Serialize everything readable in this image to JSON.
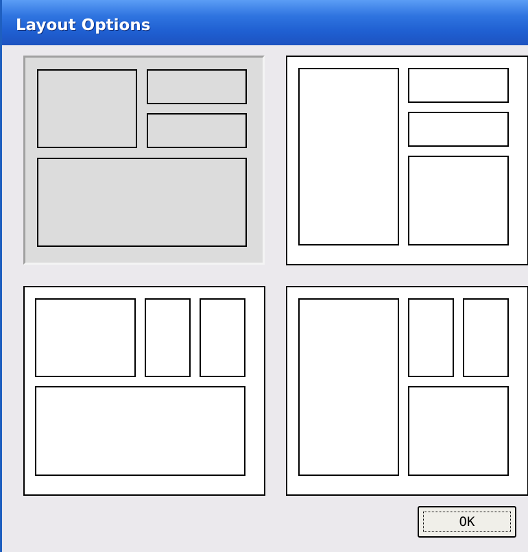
{
  "dialog": {
    "title": "Layout Options",
    "ok_label": "OK",
    "selected_layout": 1
  },
  "layouts": [
    {
      "id": 1,
      "name": "layout-option-1",
      "panes": 4
    },
    {
      "id": 2,
      "name": "layout-option-2",
      "panes": 4
    },
    {
      "id": 3,
      "name": "layout-option-3",
      "panes": 4
    },
    {
      "id": 4,
      "name": "layout-option-4",
      "panes": 4
    }
  ],
  "colors": {
    "titlebar": "#1f5fd1",
    "dialog_bg": "#ebe9ed",
    "selected_bg": "#dcdcdc"
  }
}
